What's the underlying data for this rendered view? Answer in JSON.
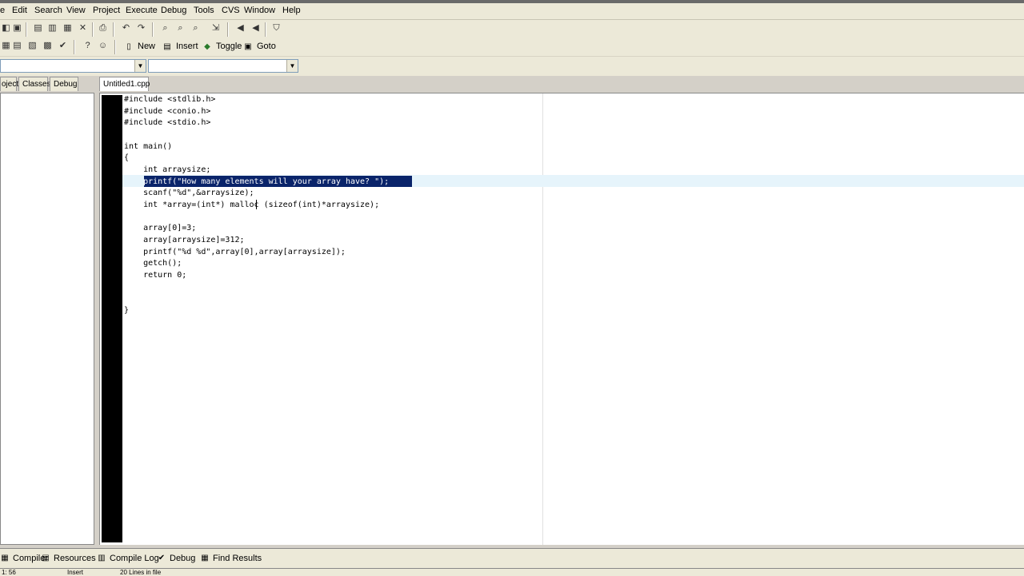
{
  "menu": {
    "items": [
      "e",
      "Edit",
      "Search",
      "View",
      "Project",
      "Execute",
      "Debug",
      "Tools",
      "CVS",
      "Window",
      "Help"
    ]
  },
  "toolbar2": {
    "new_label": "New",
    "insert_label": "Insert",
    "toggle_label": "Toggle",
    "goto_label": "Goto"
  },
  "left_tabs": [
    "oject",
    "Classes",
    "Debug"
  ],
  "editor": {
    "file_tab": "Untitled1.cpp",
    "lines": [
      "#include <stdlib.h>",
      "#include <conio.h>",
      "#include <stdio.h>",
      "",
      "int main()",
      "{",
      "    int arraysize;",
      "    printf(\"How many elements will your array have? \");",
      "    scanf(\"%d\",&arraysize);",
      "    int *array=(int*) malloc (sizeof(int)*arraysize);",
      "",
      "    array[0]=3;",
      "    array[arraysize]=312;",
      "    printf(\"%d %d\",array[0],array[arraysize]);",
      "    getch();",
      "    return 0;",
      "",
      "",
      "}"
    ],
    "selected_line_index": 7
  },
  "bottom_tabs": {
    "compiler": "Compiler",
    "resources": "Resources",
    "compile_log": "Compile Log",
    "debug": "Debug",
    "find_results": "Find Results"
  },
  "status": {
    "position": "1: 56",
    "mode": "Insert",
    "lines_info": "20 Lines in file"
  },
  "colors": {
    "selection": "#0a246a",
    "current_line": "#e6f4fb",
    "gutter": "#000000"
  }
}
